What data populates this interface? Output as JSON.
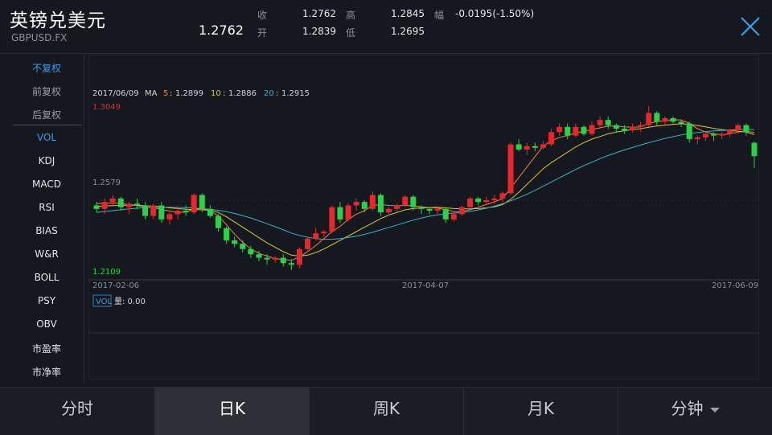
{
  "header": {
    "title": "英镑兑美元",
    "code": "GBPUSD.FX",
    "price": "1.2762",
    "quotes": [
      {
        "label": "收",
        "value": "1.2762"
      },
      {
        "label": "开",
        "value": "1.2839"
      },
      {
        "label": "高",
        "value": "1.2845"
      },
      {
        "label": "低",
        "value": "1.2695"
      },
      {
        "label": "幅",
        "value": "-0.0195(-1.50%)"
      }
    ]
  },
  "sidebar": {
    "items": [
      {
        "label": "不复权",
        "state": "active"
      },
      {
        "label": "前复权",
        "state": "dim"
      },
      {
        "label": "后复权",
        "state": "dim"
      },
      {
        "label": "VOL",
        "state": "active"
      },
      {
        "label": "KDJ",
        "state": ""
      },
      {
        "label": "MACD",
        "state": ""
      },
      {
        "label": "RSI",
        "state": ""
      },
      {
        "label": "BIAS",
        "state": ""
      },
      {
        "label": "W&R",
        "state": ""
      },
      {
        "label": "BOLL",
        "state": ""
      },
      {
        "label": "PSY",
        "state": ""
      },
      {
        "label": "OBV",
        "state": ""
      },
      {
        "label": "市盈率",
        "state": ""
      },
      {
        "label": "市净率",
        "state": ""
      }
    ]
  },
  "chart": {
    "date": "2017/06/09",
    "ma_label": "MA",
    "ma": [
      {
        "key": "5",
        "value": "1.2899",
        "color": "#e8863a"
      },
      {
        "key": "10",
        "value": "1.2886",
        "color": "#d8c83a"
      },
      {
        "key": "20",
        "value": "1.2915",
        "color": "#3ab0c8"
      }
    ],
    "ymax_label": "1.3049",
    "ymid_label": "1.2579",
    "ymin_label": "1.2109",
    "x_labels": [
      "2017-02-06",
      "2017-04-07",
      "2017-06-09"
    ],
    "vol_tag": "VOL",
    "vol_text": "量: 0.00",
    "colors": {
      "up": "#e8262d",
      "down": "#2dd04a"
    }
  },
  "chart_data": {
    "type": "candlestick",
    "ylim": [
      1.2109,
      1.3049
    ],
    "candles": [
      [
        1.248,
        1.25,
        1.244,
        1.246
      ],
      [
        1.246,
        1.252,
        1.243,
        1.25
      ],
      [
        1.25,
        1.254,
        1.248,
        1.252
      ],
      [
        1.252,
        1.253,
        1.245,
        1.247
      ],
      [
        1.247,
        1.25,
        1.243,
        1.249
      ],
      [
        1.249,
        1.252,
        1.246,
        1.248
      ],
      [
        1.248,
        1.25,
        1.24,
        1.242
      ],
      [
        1.242,
        1.249,
        1.24,
        1.248
      ],
      [
        1.248,
        1.25,
        1.238,
        1.24
      ],
      [
        1.24,
        1.244,
        1.237,
        1.243
      ],
      [
        1.243,
        1.247,
        1.24,
        1.245
      ],
      [
        1.245,
        1.248,
        1.242,
        1.244
      ],
      [
        1.244,
        1.255,
        1.243,
        1.254
      ],
      [
        1.254,
        1.255,
        1.244,
        1.246
      ],
      [
        1.246,
        1.248,
        1.241,
        1.242
      ],
      [
        1.242,
        1.243,
        1.233,
        1.235
      ],
      [
        1.235,
        1.236,
        1.226,
        1.228
      ],
      [
        1.228,
        1.23,
        1.224,
        1.226
      ],
      [
        1.226,
        1.228,
        1.221,
        1.223
      ],
      [
        1.223,
        1.225,
        1.218,
        1.22
      ],
      [
        1.22,
        1.222,
        1.216,
        1.218
      ],
      [
        1.218,
        1.22,
        1.214,
        1.217
      ],
      [
        1.217,
        1.219,
        1.215,
        1.218
      ],
      [
        1.218,
        1.22,
        1.213,
        1.215
      ],
      [
        1.215,
        1.217,
        1.211,
        1.214
      ],
      [
        1.214,
        1.224,
        1.212,
        1.223
      ],
      [
        1.223,
        1.23,
        1.222,
        1.229
      ],
      [
        1.229,
        1.235,
        1.228,
        1.232
      ],
      [
        1.232,
        1.234,
        1.23,
        1.233
      ],
      [
        1.233,
        1.248,
        1.232,
        1.247
      ],
      [
        1.247,
        1.25,
        1.238,
        1.24
      ],
      [
        1.24,
        1.249,
        1.239,
        1.248
      ],
      [
        1.248,
        1.252,
        1.245,
        1.25
      ],
      [
        1.25,
        1.251,
        1.244,
        1.246
      ],
      [
        1.246,
        1.256,
        1.245,
        1.254
      ],
      [
        1.254,
        1.255,
        1.242,
        1.244
      ],
      [
        1.244,
        1.247,
        1.242,
        1.246
      ],
      [
        1.246,
        1.249,
        1.244,
        1.248
      ],
      [
        1.248,
        1.254,
        1.247,
        1.253
      ],
      [
        1.253,
        1.254,
        1.245,
        1.247
      ],
      [
        1.247,
        1.248,
        1.243,
        1.246
      ],
      [
        1.246,
        1.247,
        1.243,
        1.245
      ],
      [
        1.245,
        1.247,
        1.243,
        1.246
      ],
      [
        1.246,
        1.247,
        1.238,
        1.24
      ],
      [
        1.24,
        1.244,
        1.239,
        1.243
      ],
      [
        1.243,
        1.248,
        1.242,
        1.247
      ],
      [
        1.247,
        1.253,
        1.246,
        1.252
      ],
      [
        1.252,
        1.253,
        1.248,
        1.25
      ],
      [
        1.25,
        1.253,
        1.248,
        1.251
      ],
      [
        1.251,
        1.254,
        1.249,
        1.252
      ],
      [
        1.252,
        1.256,
        1.25,
        1.255
      ],
      [
        1.255,
        1.284,
        1.254,
        1.283
      ],
      [
        1.283,
        1.286,
        1.279,
        1.28
      ],
      [
        1.28,
        1.284,
        1.277,
        1.282
      ],
      [
        1.282,
        1.284,
        1.279,
        1.281
      ],
      [
        1.281,
        1.285,
        1.28,
        1.283
      ],
      [
        1.283,
        1.292,
        1.282,
        1.29
      ],
      [
        1.29,
        1.295,
        1.288,
        1.293
      ],
      [
        1.293,
        1.295,
        1.286,
        1.288
      ],
      [
        1.288,
        1.295,
        1.287,
        1.293
      ],
      [
        1.293,
        1.294,
        1.288,
        1.289
      ],
      [
        1.289,
        1.296,
        1.288,
        1.294
      ],
      [
        1.294,
        1.299,
        1.292,
        1.297
      ],
      [
        1.297,
        1.299,
        1.292,
        1.294
      ],
      [
        1.294,
        1.295,
        1.29,
        1.292
      ],
      [
        1.292,
        1.294,
        1.289,
        1.291
      ],
      [
        1.291,
        1.295,
        1.29,
        1.293
      ],
      [
        1.293,
        1.296,
        1.29,
        1.294
      ],
      [
        1.294,
        1.3049,
        1.293,
        1.301
      ],
      [
        1.301,
        1.302,
        1.294,
        1.296
      ],
      [
        1.296,
        1.299,
        1.294,
        1.298
      ],
      [
        1.298,
        1.299,
        1.295,
        1.296
      ],
      [
        1.296,
        1.297,
        1.293,
        1.295
      ],
      [
        1.295,
        1.296,
        1.284,
        1.286
      ],
      [
        1.286,
        1.288,
        1.283,
        1.287
      ],
      [
        1.287,
        1.29,
        1.285,
        1.289
      ],
      [
        1.289,
        1.29,
        1.285,
        1.288
      ],
      [
        1.288,
        1.29,
        1.286,
        1.289
      ],
      [
        1.289,
        1.292,
        1.287,
        1.291
      ],
      [
        1.291,
        1.295,
        1.289,
        1.294
      ],
      [
        1.294,
        1.295,
        1.288,
        1.29
      ],
      [
        1.2839,
        1.2845,
        1.2695,
        1.2762
      ]
    ],
    "ma5": [
      1.249,
      1.2492,
      1.2494,
      1.249,
      1.2485,
      1.248,
      1.2468,
      1.247,
      1.2455,
      1.2448,
      1.244,
      1.2442,
      1.246,
      1.2462,
      1.245,
      1.242,
      1.237,
      1.2315,
      1.227,
      1.223,
      1.2205,
      1.219,
      1.2175,
      1.217,
      1.2165,
      1.2185,
      1.2215,
      1.225,
      1.229,
      1.233,
      1.236,
      1.24,
      1.243,
      1.245,
      1.248,
      1.2485,
      1.248,
      1.2478,
      1.248,
      1.2478,
      1.2472,
      1.2468,
      1.2465,
      1.2455,
      1.2445,
      1.2445,
      1.2455,
      1.247,
      1.2485,
      1.25,
      1.2518,
      1.258,
      1.264,
      1.27,
      1.276,
      1.282,
      1.285,
      1.287,
      1.288,
      1.2895,
      1.2905,
      1.2915,
      1.2925,
      1.2935,
      1.2935,
      1.293,
      1.2928,
      1.293,
      1.295,
      1.296,
      1.2965,
      1.297,
      1.297,
      1.295,
      1.292,
      1.29,
      1.289,
      1.2885,
      1.289,
      1.29,
      1.2905,
      1.2899
    ],
    "ma10": [
      1.2475,
      1.2477,
      1.2479,
      1.248,
      1.2481,
      1.2481,
      1.2478,
      1.2476,
      1.2472,
      1.2466,
      1.2462,
      1.2458,
      1.2457,
      1.2455,
      1.2452,
      1.244,
      1.2415,
      1.2385,
      1.2355,
      1.2325,
      1.2295,
      1.2265,
      1.224,
      1.2215,
      1.2195,
      1.219,
      1.2195,
      1.221,
      1.223,
      1.2255,
      1.228,
      1.2305,
      1.233,
      1.2355,
      1.238,
      1.2405,
      1.2425,
      1.244,
      1.2455,
      1.2462,
      1.2466,
      1.2468,
      1.247,
      1.2466,
      1.2462,
      1.246,
      1.246,
      1.2462,
      1.2466,
      1.2472,
      1.2485,
      1.2515,
      1.2555,
      1.26,
      1.2645,
      1.269,
      1.2725,
      1.2755,
      1.2785,
      1.2815,
      1.284,
      1.286,
      1.2875,
      1.289,
      1.29,
      1.2908,
      1.2915,
      1.292,
      1.2928,
      1.2935,
      1.294,
      1.2945,
      1.2948,
      1.2945,
      1.2938,
      1.293,
      1.2922,
      1.2915,
      1.291,
      1.2905,
      1.29,
      1.2886
    ],
    "ma20": [
      1.244,
      1.2445,
      1.245,
      1.2455,
      1.246,
      1.2464,
      1.2467,
      1.2469,
      1.247,
      1.247,
      1.2469,
      1.2467,
      1.2465,
      1.2462,
      1.2458,
      1.2452,
      1.2444,
      1.2434,
      1.2422,
      1.2408,
      1.2392,
      1.2375,
      1.2358,
      1.234,
      1.2322,
      1.2308,
      1.2298,
      1.229,
      1.2286,
      1.2286,
      1.229,
      1.2296,
      1.2304,
      1.2314,
      1.2326,
      1.234,
      1.2354,
      1.2368,
      1.2382,
      1.2396,
      1.2408,
      1.2418,
      1.2426,
      1.2432,
      1.2436,
      1.244,
      1.2446,
      1.2454,
      1.2464,
      1.2476,
      1.249,
      1.2506,
      1.2524,
      1.2544,
      1.2566,
      1.259,
      1.2614,
      1.2638,
      1.2662,
      1.2686,
      1.2708,
      1.2728,
      1.2748,
      1.2766,
      1.2782,
      1.2798,
      1.2812,
      1.2826,
      1.284,
      1.2852,
      1.2864,
      1.2874,
      1.2884,
      1.2892,
      1.2898,
      1.2903,
      1.2907,
      1.291,
      1.2912,
      1.2914,
      1.2915,
      1.2915
    ]
  },
  "tabs": [
    {
      "label": "分时",
      "active": false
    },
    {
      "label": "日K",
      "active": true
    },
    {
      "label": "周K",
      "active": false
    },
    {
      "label": "月K",
      "active": false
    },
    {
      "label": "分钟",
      "active": false,
      "dropdown": true
    }
  ]
}
